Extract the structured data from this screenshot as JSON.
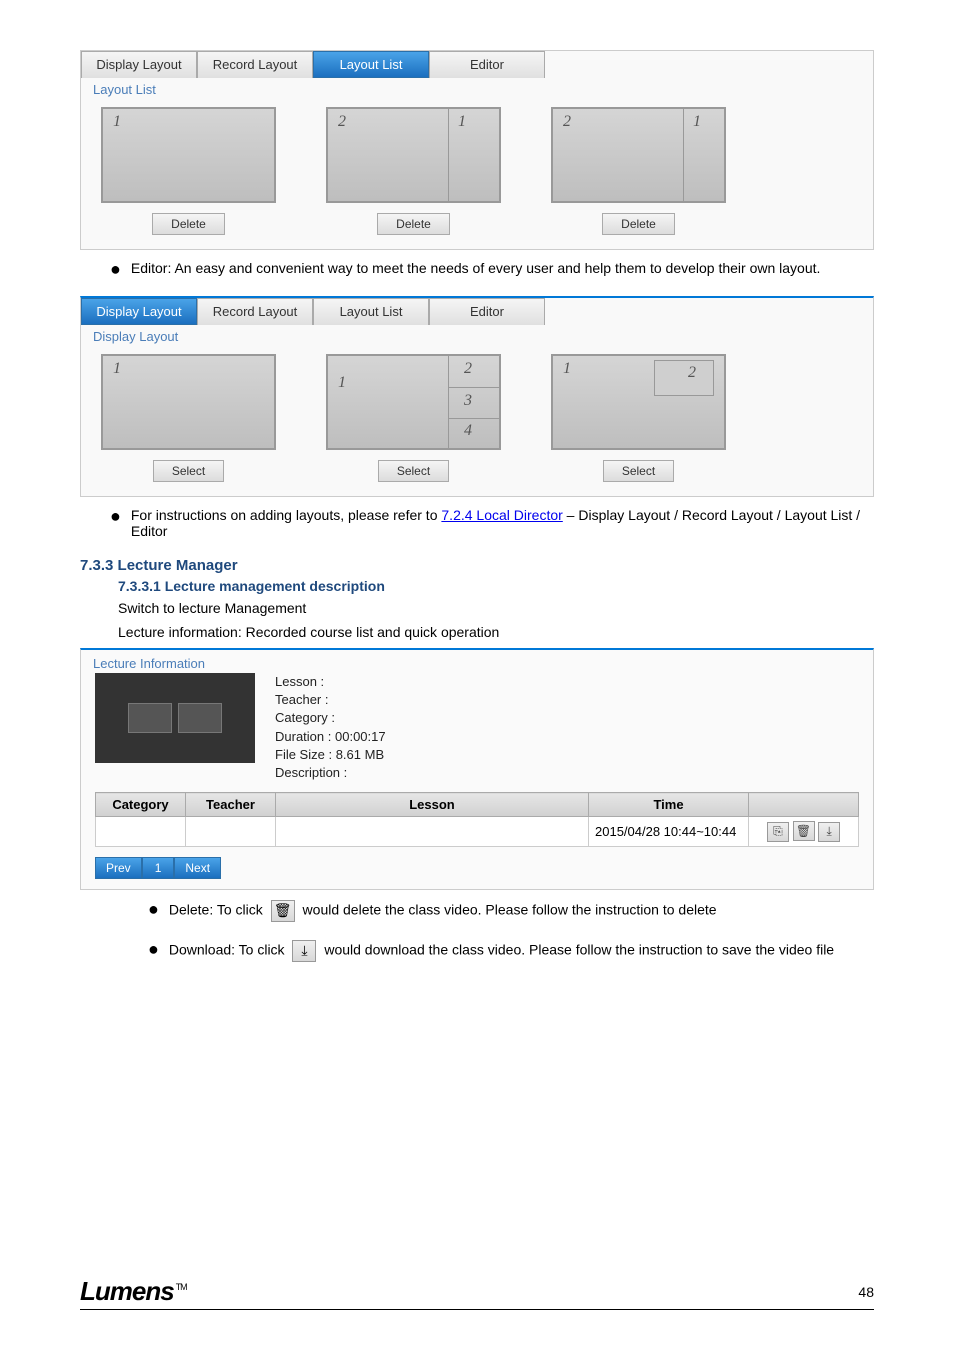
{
  "screenshot1": {
    "tabs": [
      "Display Layout",
      "Record Layout",
      "Layout List",
      "Editor"
    ],
    "active_tab_index": 2,
    "fieldset": "Layout List",
    "buttons": [
      "Delete",
      "Delete",
      "Delete"
    ],
    "thumbs": [
      {
        "labels": [
          "1"
        ]
      },
      {
        "labels": [
          "2",
          "1"
        ]
      },
      {
        "labels": [
          "2",
          "1"
        ]
      }
    ]
  },
  "bullet1": "Editor: An easy and convenient way to meet the needs of every user and help them to develop their own layout.",
  "screenshot2": {
    "tabs": [
      "Display Layout",
      "Record Layout",
      "Layout List",
      "Editor"
    ],
    "active_tab_index": 0,
    "fieldset": "Display Layout",
    "buttons": [
      "Select",
      "Select",
      "Select"
    ],
    "thumbs": [
      {
        "labels": [
          "1"
        ]
      },
      {
        "labels": [
          "1",
          "2",
          "3",
          "4"
        ]
      },
      {
        "labels": [
          "1",
          "2"
        ]
      }
    ]
  },
  "bullet2_prefix": "For instructions on adding layouts, please refer to ",
  "bullet2_link": "7.2.4 Local Director",
  "bullet2_suffix": " – Display Layout / Record Layout / Layout List / Editor",
  "sec": {
    "heading": "7.3.3 Lecture Manager",
    "sub1": "7.3.3.1 Lecture management description",
    "line1": "Switch to lecture Management",
    "line2": "Lecture information: Recorded course list and quick operation"
  },
  "lecture": {
    "fieldset": "Lecture Information",
    "meta": {
      "lesson_label": "Lesson :",
      "teacher_label": "Teacher :",
      "category_label": "Category :",
      "duration_label": "Duration :",
      "duration_value": "00:00:17",
      "filesize_label": "File Size :",
      "filesize_value": "8.61 MB",
      "description_label": "Description :"
    },
    "table": {
      "headers": [
        "Category",
        "Teacher",
        "Lesson",
        "Time",
        ""
      ],
      "row": {
        "category": "",
        "teacher": "",
        "lesson": "",
        "time": "2015/04/28 10:44~10:44"
      }
    },
    "pager": {
      "prev": "Prev",
      "page": "1",
      "next": "Next"
    }
  },
  "bullet3": {
    "prefix": "Delete: To click ",
    "suffix": " would delete the class video. Please follow the instruction to delete"
  },
  "bullet4": {
    "prefix": "Download: To click ",
    "suffix": " would download the class video. Please follow the instruction to save the video file"
  },
  "footer": {
    "logo": "Lumens",
    "tm": "TM",
    "page": "48"
  },
  "icons": {
    "copy_glyph": "⎘",
    "trash_glyph": "🗑",
    "download_glyph": "⤓"
  }
}
